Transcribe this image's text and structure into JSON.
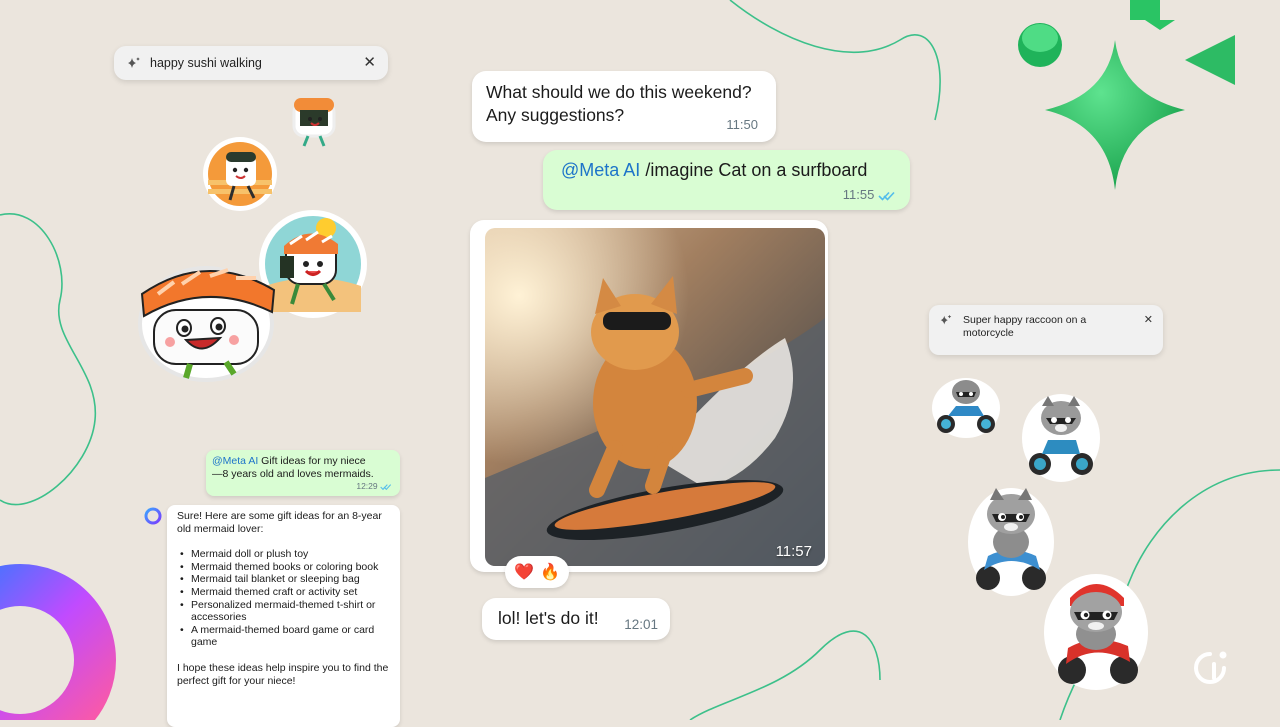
{
  "colors": {
    "background": "#ebe5dd",
    "incoming_bubble": "#ffffff",
    "outgoing_bubble": "#d9fdd3",
    "mention": "#1d74c9",
    "read_tick": "#53bdeb",
    "accent_green": "#25d366",
    "line_green": "#3cc08a"
  },
  "sticker_search_sushi": {
    "icon": "sparkle-icon",
    "query": "happy sushi walking",
    "close_icon": "close-icon"
  },
  "sticker_search_raccoon": {
    "icon": "sparkle-icon",
    "query": "Super happy raccoon on a motorcycle",
    "close_icon": "close-icon"
  },
  "chat": {
    "msg1": {
      "text_line1": "What should we do this weekend?",
      "text_line2": "Any suggestions?",
      "time": "11:50"
    },
    "msg2": {
      "mention": "@Meta AI",
      "text": " /imagine Cat on a surfboard",
      "time": "11:55",
      "status_icon": "double-check-icon"
    },
    "image_msg": {
      "subject": "cat-on-surfboard",
      "time": "11:57",
      "reactions": [
        "❤️",
        "🔥"
      ]
    },
    "msg3": {
      "text": "lol! let's do it!",
      "time": "12:01"
    }
  },
  "gift_chat": {
    "question": {
      "mention": "@Meta AI",
      "text_line1": " Gift ideas for my niece",
      "text_line2": "—8 years old and loves mermaids.",
      "time": "12:29",
      "status_icon": "double-check-icon"
    },
    "answer": {
      "avatar_icon": "meta-ai-ring-icon",
      "intro": "Sure! Here are some gift ideas for an 8-year old mermaid lover:",
      "items": [
        "Mermaid doll or plush toy",
        "Mermaid themed books or coloring book",
        "Mermaid tail blanket or sleeping bag",
        "Mermaid themed craft or activity set",
        "Personalized mermaid-themed t-shirt or accessories",
        "A mermaid-themed board game or card game"
      ],
      "outro": "I hope these ideas help inspire you to find the perfect gift for your niece!"
    }
  },
  "stickers": {
    "sushi": [
      "sushi-sticker-small",
      "sushi-sticker-sunset",
      "sushi-sticker-beach",
      "sushi-sticker-large"
    ],
    "raccoon": [
      "raccoon-sticker-1",
      "raccoon-sticker-2",
      "raccoon-sticker-3",
      "raccoon-sticker-4"
    ]
  },
  "decor": {
    "brand_icon": "brand-logo-icon",
    "star_icon": "green-star-3d-icon"
  }
}
